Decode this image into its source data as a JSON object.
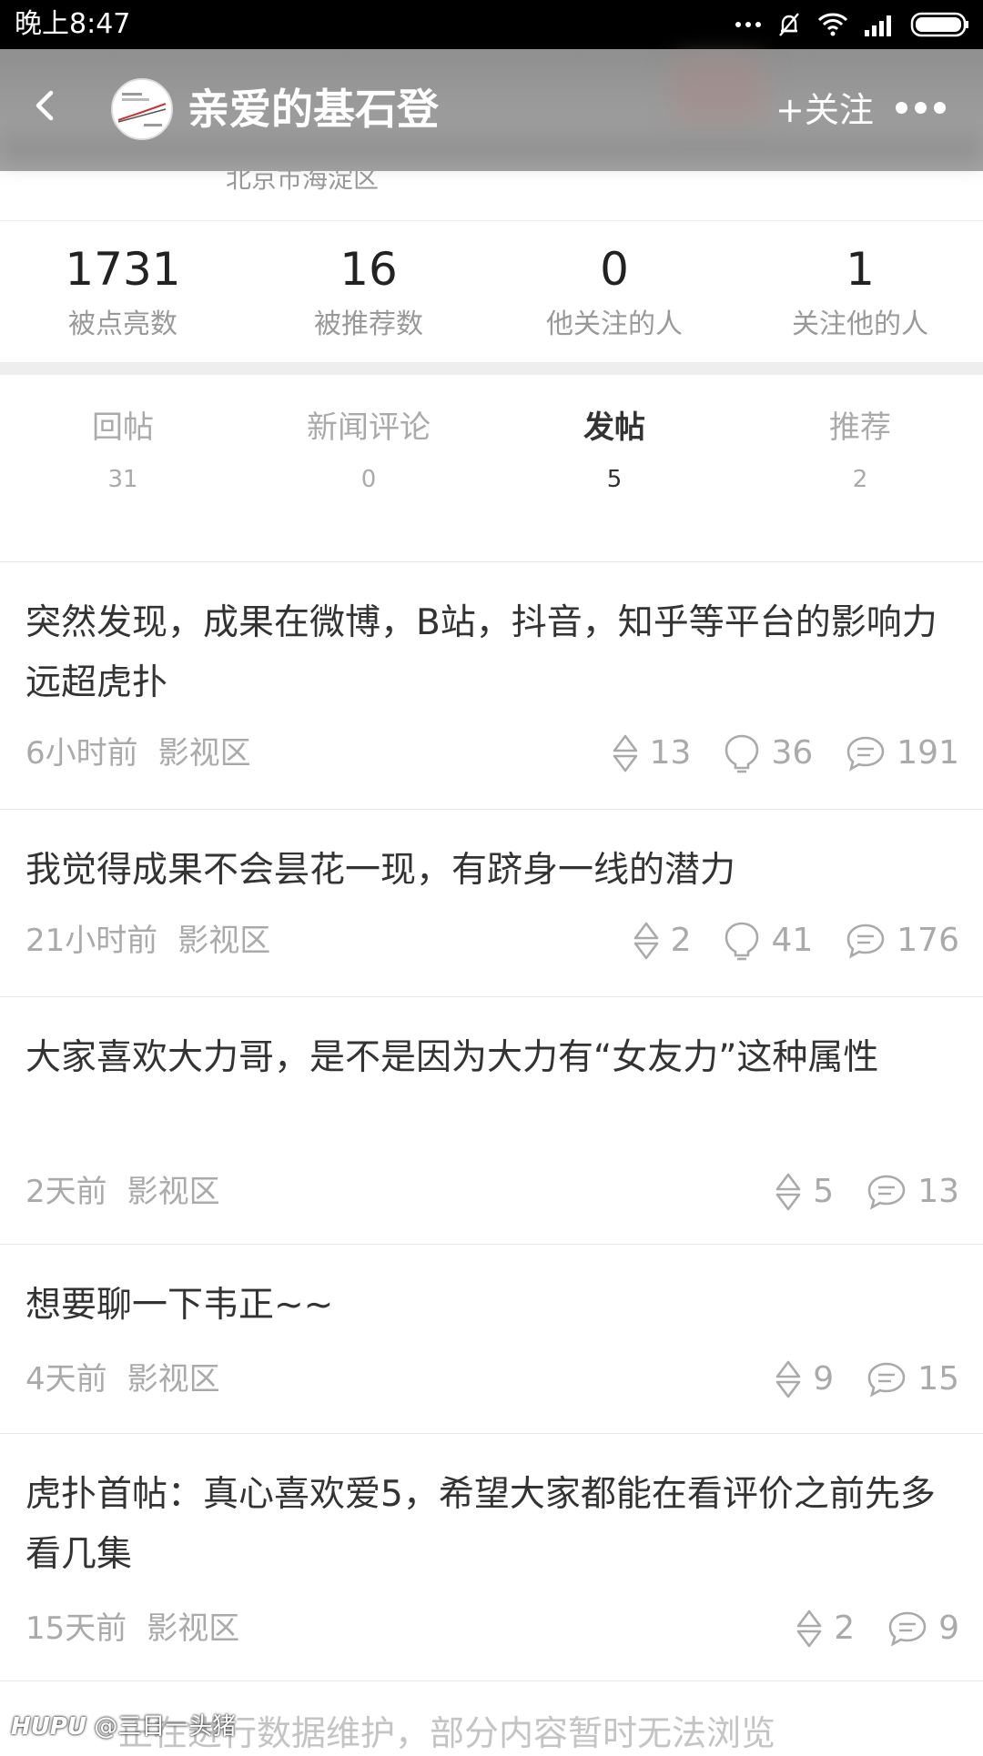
{
  "status_bar": {
    "time": "晚上8:47"
  },
  "header": {
    "title": "亲爱的基石登",
    "follow_label": "+关注"
  },
  "profile": {
    "location": "北京市海淀区"
  },
  "stats": [
    {
      "value": "1731",
      "label": "被点亮数"
    },
    {
      "value": "16",
      "label": "被推荐数"
    },
    {
      "value": "0",
      "label": "他关注的人"
    },
    {
      "value": "1",
      "label": "关注他的人"
    }
  ],
  "tabs": [
    {
      "label": "回帖",
      "count": "31",
      "active": false
    },
    {
      "label": "新闻评论",
      "count": "0",
      "active": false
    },
    {
      "label": "发帖",
      "count": "5",
      "active": true
    },
    {
      "label": "推荐",
      "count": "2",
      "active": false
    }
  ],
  "posts": [
    {
      "title": "突然发现，成果在微博，B站，抖音，知乎等平台的影响力远超虎扑",
      "time": "6小时前",
      "board": "影视区",
      "recommend": "13",
      "light": "36",
      "replies": "191"
    },
    {
      "title": "我觉得成果不会昙花一现，有跻身一线的潜力",
      "time": "21小时前",
      "board": "影视区",
      "recommend": "2",
      "light": "41",
      "replies": "176"
    },
    {
      "title": "大家喜欢大力哥，是不是因为大力有“女友力”这种属性",
      "time": "2天前",
      "board": "影视区",
      "recommend": "5",
      "replies": "13"
    },
    {
      "title": "想要聊一下韦正~~",
      "time": "4天前",
      "board": "影视区",
      "recommend": "9",
      "replies": "15"
    },
    {
      "title": "虎扑首帖：真心喜欢爱5，希望大家都能在看评价之前先多看几集",
      "time": "15天前",
      "board": "影视区",
      "recommend": "2",
      "replies": "9"
    }
  ],
  "notice": "正在进行数据维护，部分内容暂时无法浏览",
  "watermark": {
    "brand": "HUPU",
    "user": "@三日一头猪"
  },
  "colors": {
    "header_bg": "#9a9a9a",
    "text_primary": "#333333",
    "text_muted": "#aaaaaa",
    "divider": "#eeeeee"
  },
  "icons": [
    "back-arrow-icon",
    "more-dots-icon",
    "recommend-icon",
    "light-bulb-icon",
    "comment-icon",
    "wifi-icon",
    "signal-icon",
    "battery-icon",
    "mute-bell-icon"
  ]
}
